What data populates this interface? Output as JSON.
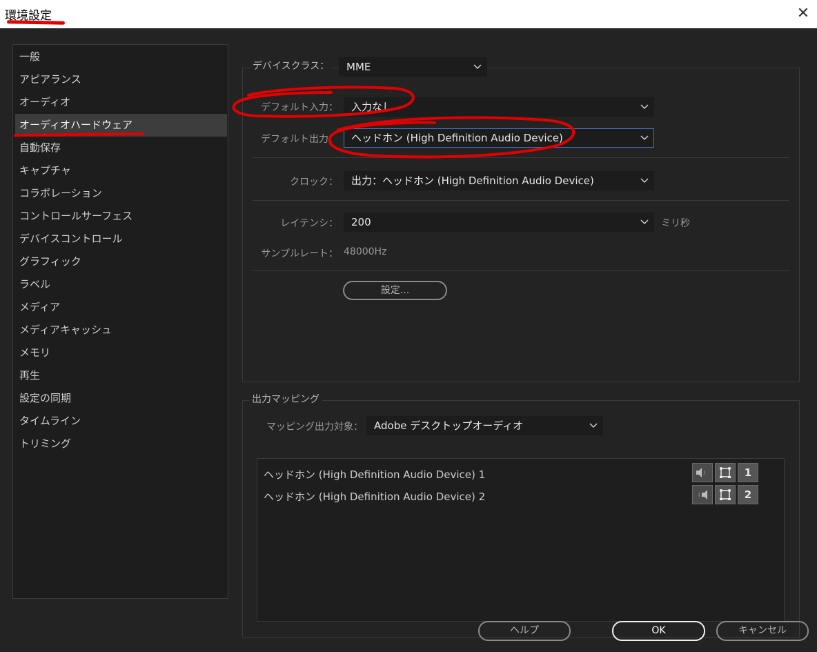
{
  "window": {
    "title": "環境設定",
    "close_glyph": "✕"
  },
  "sidebar": {
    "items": [
      {
        "label": "一般"
      },
      {
        "label": "アピアランス"
      },
      {
        "label": "オーディオ"
      },
      {
        "label": "オーディオハードウェア",
        "selected": true
      },
      {
        "label": "自動保存"
      },
      {
        "label": "キャプチャ"
      },
      {
        "label": "コラボレーション"
      },
      {
        "label": "コントロールサーフェス"
      },
      {
        "label": "デバイスコントロール"
      },
      {
        "label": "グラフィック"
      },
      {
        "label": "ラベル"
      },
      {
        "label": "メディア"
      },
      {
        "label": "メディアキャッシュ"
      },
      {
        "label": "メモリ"
      },
      {
        "label": "再生"
      },
      {
        "label": "設定の同期"
      },
      {
        "label": "タイムライン"
      },
      {
        "label": "トリミング"
      }
    ]
  },
  "device": {
    "class_label": "デバイスクラス：",
    "class_value": "MME",
    "default_input_label": "デフォルト入力：",
    "default_input_value": "入力なし",
    "default_output_label": "デフォルト出力：",
    "default_output_value": "ヘッドホン (High Definition Audio Device)",
    "clock_label": "クロック：",
    "clock_value": "出力：ヘッドホン (High Definition Audio Device)",
    "latency_label": "レイテンシ：",
    "latency_value": "200",
    "latency_unit": "ミリ秒",
    "sample_rate_label": "サンプルレート：",
    "sample_rate_value": "48000Hz",
    "settings_button": "設定..."
  },
  "mapping": {
    "legend": "出力マッピング",
    "target_label": "マッピング出力対象：",
    "target_value": "Adobe デスクトップオーディオ",
    "rows": [
      {
        "label": "ヘッドホン (High Definition Audio Device) 1",
        "channel": "1"
      },
      {
        "label": "ヘッドホン (High Definition Audio Device) 2",
        "channel": "2"
      }
    ]
  },
  "footer": {
    "help": "ヘルプ",
    "ok": "OK",
    "cancel": "キャンセル"
  },
  "colors": {
    "annotation_red": "#e00000",
    "focus_blue": "#4a74c6",
    "background": "#232323"
  }
}
